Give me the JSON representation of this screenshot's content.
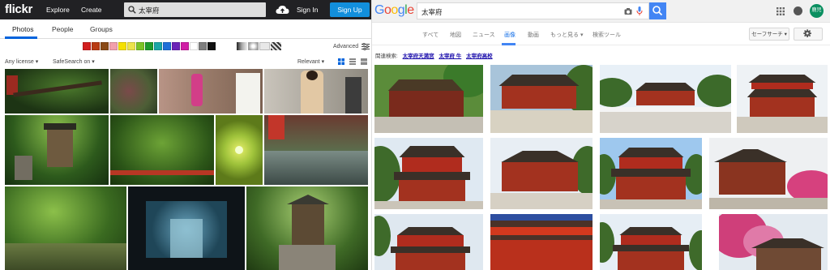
{
  "flickr": {
    "logo": "flickr",
    "nav": {
      "explore": "Explore",
      "create": "Create"
    },
    "search": {
      "query": "太宰府",
      "icon": "search-icon"
    },
    "upload_icon": "cloud-upload-icon",
    "signin": "Sign In",
    "signup": "Sign Up",
    "tabs": [
      "Photos",
      "People",
      "Groups"
    ],
    "active_tab": "Photos",
    "color_filters": [
      "#d21f1f",
      "#b93b14",
      "#8a4a16",
      "#f2a0ac",
      "#f5e000",
      "#ece34b",
      "#7cc326",
      "#1d9a2c",
      "#1aa6a6",
      "#1f6fd8",
      "#6b24b8",
      "#d01ea5",
      "#ffffff",
      "#7f7f7f",
      "#111111"
    ],
    "style_filters": [
      "black-and-white-style",
      "shallow-depth-style",
      "minimal-style",
      "pattern-style"
    ],
    "advanced": "Advanced",
    "filters": {
      "license": "Any license",
      "safesearch": "SafeSearch on",
      "sort": "Relevant"
    }
  },
  "google": {
    "logo_letters": [
      {
        "ch": "G",
        "color": "#4285f4"
      },
      {
        "ch": "o",
        "color": "#ea4335"
      },
      {
        "ch": "o",
        "color": "#fbbc05"
      },
      {
        "ch": "g",
        "color": "#4285f4"
      },
      {
        "ch": "l",
        "color": "#34a853"
      },
      {
        "ch": "e",
        "color": "#ea4335"
      }
    ],
    "search": {
      "query": "太宰府"
    },
    "avatar_text": "鹿児",
    "tabs": [
      "すべて",
      "地図",
      "ニュース",
      "画像",
      "動画",
      "もっと見る ▾",
      "検索ツール"
    ],
    "active_tab": "画像",
    "safesearch": "セーフサーチ ▾",
    "related": {
      "label": "関連検索:",
      "links": [
        "太宰府天満宮",
        "太宰府 牛",
        "太宰府高校"
      ]
    }
  }
}
